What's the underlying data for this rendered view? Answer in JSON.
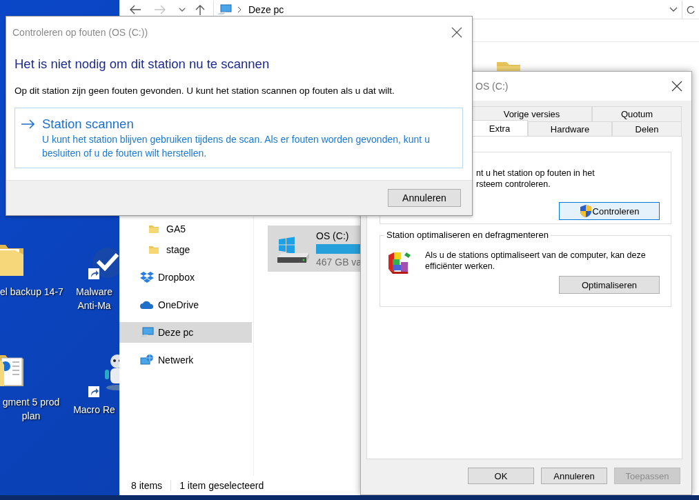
{
  "desktop": {
    "icons": [
      {
        "label": "el backup 14-7",
        "kind": "folder",
        "shortcut": false
      },
      {
        "label": "Malware Anti-Ma",
        "kind": "shield-app",
        "shortcut": true
      },
      {
        "label": "gment 5 prod plan",
        "kind": "document-folder",
        "shortcut": false
      },
      {
        "label": "Macro Re",
        "kind": "robot-app",
        "shortcut": true
      }
    ]
  },
  "explorer": {
    "address": "Deze pc",
    "nav_items": [
      {
        "label": "GA5",
        "kind": "folder",
        "selected": false
      },
      {
        "label": "stage",
        "kind": "folder",
        "selected": false
      },
      {
        "label": "Dropbox",
        "kind": "dropbox",
        "selected": false
      },
      {
        "label": "OneDrive",
        "kind": "cloud",
        "selected": false
      },
      {
        "label": "Deze pc",
        "kind": "pc",
        "selected": true
      },
      {
        "label": "Netwerk",
        "kind": "network",
        "selected": false
      }
    ],
    "drives": [
      {
        "name": "OS (C:)",
        "level": 0.4,
        "free": "467 GB va",
        "selected": true
      }
    ],
    "status_bar": [
      "8 items",
      "1 item geselecteerd"
    ]
  },
  "properties": {
    "title": "OS (C:)",
    "tab_rows": [
      [
        {
          "label": "Vorige versies",
          "selected": false
        },
        {
          "label": "Quotum",
          "selected": false
        }
      ],
      [
        {
          "label": "Extra",
          "selected": true
        },
        {
          "label": "Hardware",
          "selected": false
        },
        {
          "label": "Delen",
          "selected": false
        }
      ]
    ],
    "groups": [
      {
        "kind": "check",
        "text": "nt u het station op fouten in het\nrsteem controleren.",
        "button": {
          "label": "Controleren",
          "kind": "shield",
          "focused": true
        }
      },
      {
        "title": "Station optimaliseren en defragmenteren",
        "text": "Als u de stations optimaliseert van de computer, kan deze efficiënter werken.",
        "kind": "defrag",
        "button": {
          "label": "Optimaliseren",
          "kind": "plain",
          "focused": false
        }
      }
    ],
    "buttons": [
      {
        "label": "OK",
        "disabled": false
      },
      {
        "label": "Annuleren",
        "disabled": false
      },
      {
        "label": "Toepassen",
        "disabled": true
      }
    ]
  },
  "check_dialog": {
    "title": "Controleren op fouten (OS (C:))",
    "heading": "Het is niet nodig om dit station nu te scannen",
    "message": "Op dit station zijn geen fouten gevonden. U kunt het station scannen op fouten als u dat wilt.",
    "action": {
      "label": "Station scannen",
      "description": "U kunt het station blijven gebruiken tijdens de scan. Als er fouten worden gevonden, kunt u besluiten of u de fouten wilt herstellen."
    },
    "buttons": [
      "Annuleren"
    ]
  }
}
